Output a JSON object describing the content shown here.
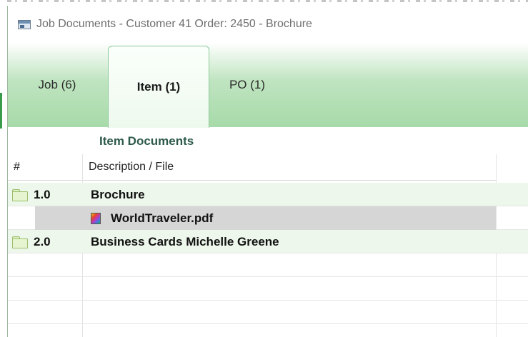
{
  "window": {
    "title": "Job Documents - Customer 41 Order: 2450 - Brochure"
  },
  "tabs": [
    {
      "label": "Job (6)"
    },
    {
      "label": "Item (1)"
    },
    {
      "label": "PO (1)"
    }
  ],
  "active_tab": "Item (1)",
  "section": {
    "title": "Item Documents"
  },
  "grid": {
    "columns": {
      "number": "#",
      "description": "Description / File"
    },
    "rows": [
      {
        "number": "1.0",
        "description": "Brochure",
        "icon": "folder-icon",
        "type": "folder"
      },
      {
        "number": "",
        "description": "WorldTraveler.pdf",
        "icon": "pdf-icon",
        "type": "file",
        "selected": true
      },
      {
        "number": "2.0",
        "description": "Business Cards Michelle Greene",
        "icon": "folder-icon",
        "type": "folder"
      }
    ]
  },
  "colors": {
    "tab_green": "#a7daa9",
    "row_green": "#edf7ec",
    "selected_row": "#d6d6d6",
    "section_title": "#2d5a4a"
  }
}
